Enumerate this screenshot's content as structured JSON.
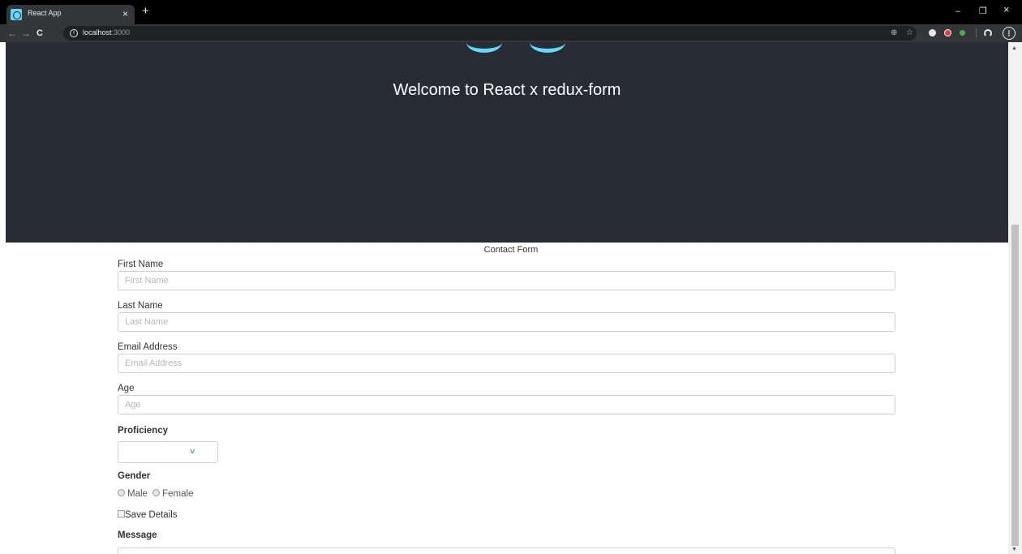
{
  "browser": {
    "tab_title": "React App",
    "tab_close": "×",
    "new_tab": "+",
    "window_controls": {
      "minimize": "–",
      "restore": "❐",
      "close": "×"
    },
    "nav": {
      "back": "←",
      "forward": "→",
      "reload": "C"
    },
    "url_host": "localhost",
    "url_port": ":3000",
    "menu": "⋮"
  },
  "header": {
    "welcome": "Welcome to React x redux-form"
  },
  "form": {
    "title": "Contact Form",
    "first_name": {
      "label": "First Name",
      "placeholder": "First Name"
    },
    "last_name": {
      "label": "Last Name",
      "placeholder": "Last Name"
    },
    "email": {
      "label": "Email Address",
      "placeholder": "Email Address"
    },
    "age": {
      "label": "Age",
      "placeholder": "Age"
    },
    "proficiency": {
      "label": "Proficiency",
      "value": ""
    },
    "gender": {
      "label": "Gender",
      "options": [
        "Male",
        "Female"
      ]
    },
    "save_details": "Save Details",
    "message": {
      "label": "Message"
    }
  },
  "colors": {
    "header_bg": "#282c34",
    "react_blue": "#61dafb"
  }
}
